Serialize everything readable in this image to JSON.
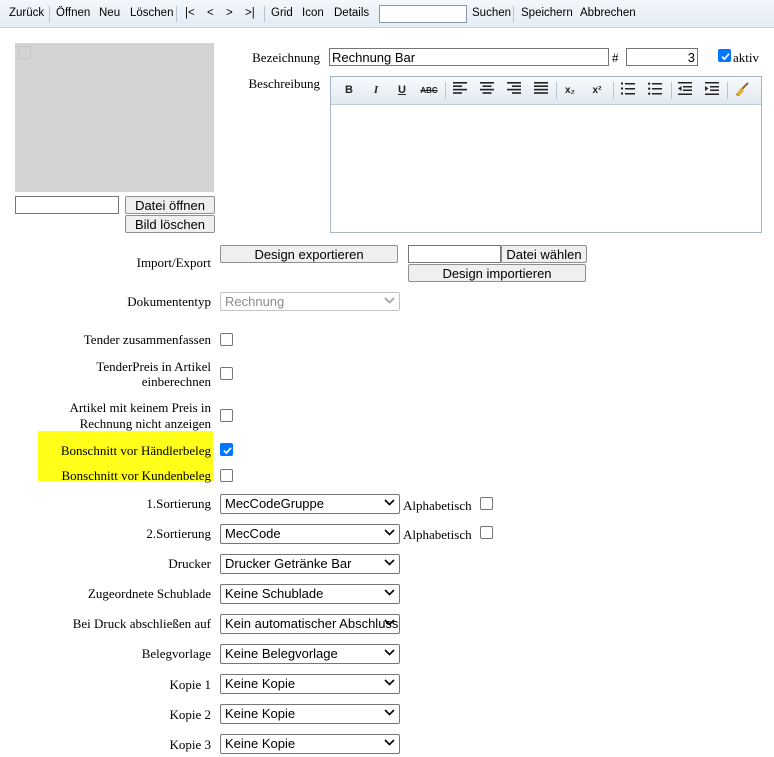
{
  "toolbar": {
    "back": "Zurück",
    "open": "Öffnen",
    "new": "Neu",
    "delete": "Löschen",
    "first": "|<",
    "prev": "<",
    "next": ">",
    "last": ">|",
    "grid": "Grid",
    "icon": "Icon",
    "details": "Details",
    "search_value": "",
    "search": "Suchen",
    "save": "Speichern",
    "cancel": "Abbrechen"
  },
  "image": {
    "file_input_value": "",
    "open_file": "Datei öffnen",
    "delete_image": "Bild löschen"
  },
  "header": {
    "name_label": "Bezeichnung",
    "name_value": "Rechnung Bar",
    "number_label": "#",
    "number_value": "3",
    "active_label": "aktiv",
    "active_checked": true,
    "description_label": "Beschreibung"
  },
  "editor": {
    "bold": "B",
    "italic": "I",
    "underline": "U",
    "strike": "ABC",
    "sub": "x₂",
    "sup": "x²"
  },
  "import_export": {
    "label": "Import/Export",
    "export_button": "Design exportieren",
    "file_value": "",
    "choose_file": "Datei wählen",
    "import_button": "Design importieren"
  },
  "doctype": {
    "label": "Dokumententyp",
    "value": "Rechnung"
  },
  "options": [
    {
      "label": "Tender zusammenfassen",
      "checked": false
    },
    {
      "label1": "TenderPreis in Artikel",
      "label2": "einberechnen",
      "checked": false
    },
    {
      "label1": "Artikel mit keinem Preis in",
      "label2": "Rechnung nicht anzeigen",
      "checked": false
    },
    {
      "label": "Bonschnitt vor Händlerbeleg",
      "checked": true,
      "highlight": "#ffff1a"
    },
    {
      "label": "Bonschnitt vor Kundenbeleg",
      "checked": false,
      "highlight": "#ffff1a"
    }
  ],
  "sorting": {
    "sort1_label": "1.Sortierung",
    "sort1_value": "MecCodeGruppe",
    "sort2_label": "2.Sortierung",
    "sort2_value": "MecCode",
    "alpha_label": "Alphabetisch"
  },
  "selects": {
    "printer_label": "Drucker",
    "printer_value": "Drucker Getränke Bar",
    "drawer_label": "Zugeordnete Schublade",
    "drawer_value": "Keine Schublade",
    "close_label": "Bei Druck abschließen auf",
    "close_value": "Kein automatischer Abschluss",
    "template_label": "Belegvorlage",
    "template_value": "Keine Belegvorlage",
    "copy1_label": "Kopie 1",
    "copy1_value": "Keine Kopie",
    "copy2_label": "Kopie 2",
    "copy2_value": "Keine Kopie",
    "copy3_label": "Kopie 3",
    "copy3_value": "Keine Kopie"
  },
  "colors": {
    "highlight": "#ffff1a",
    "checkbox_accent": "#0075ff"
  }
}
